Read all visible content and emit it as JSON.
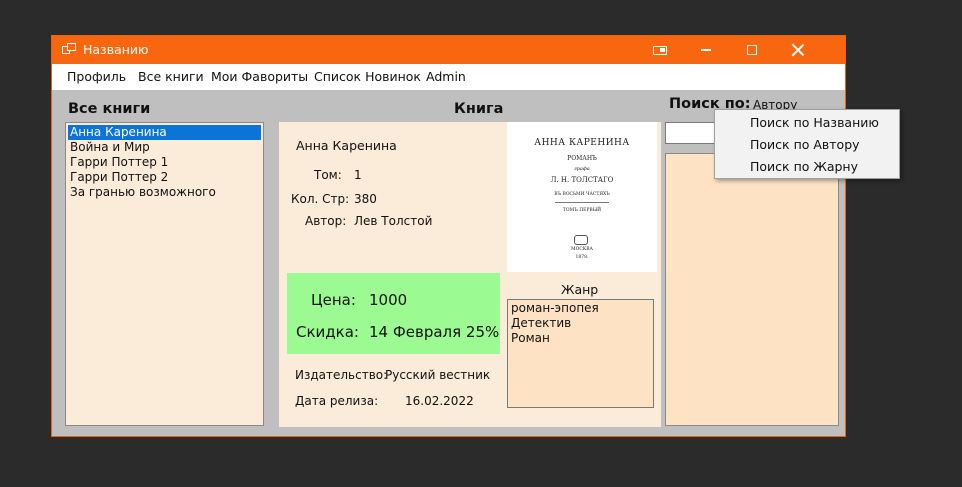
{
  "window": {
    "title": "Названию"
  },
  "menu": {
    "items": [
      "Профиль",
      "Все книги",
      "Мои Фавориты",
      "Список Новинок",
      "Admin"
    ]
  },
  "books": {
    "heading": "Все книги",
    "items": [
      "Анна Каренина",
      "Война и Мир",
      "Гарри Поттер 1",
      "Гарри Поттер 2",
      "За гранью возможного"
    ],
    "selected": "Анна Каренина"
  },
  "book": {
    "heading": "Книга",
    "title": "Анна Каренина",
    "volume_label": "Том:",
    "volume": "1",
    "pages_label": "Кол. Стр:",
    "pages": "380",
    "author_label": "Автор:",
    "author": "Лев Толстой",
    "price_label": "Цена:",
    "price": "1000",
    "discount_label": "Скидка:",
    "discount": "14 Февраля 25%",
    "publisher_label": "Издательство:",
    "publisher": "Русский вестник",
    "release_label": "Дата релиза:",
    "release": "16.02.2022",
    "genre_label": "Жанр",
    "genres": [
      "роман-эпопея",
      "Детектив",
      "Роман"
    ],
    "cover": {
      "line1": "АННА КАРЕНИНА",
      "line2": "РОМАНЪ",
      "line3": "графа",
      "line4": "Л. Н. ТОЛСТАГО",
      "line5": "ВЪ ВОСЬМИ ЧАСТЯХЪ",
      "line6": "ТОМЪ ПЕРВЫЙ",
      "line7": "МОСКВА",
      "line8": "1878."
    }
  },
  "search": {
    "label": "Поиск по:",
    "selected": "Автору",
    "options": [
      "Поиск по Названию",
      "Поиск по Автору",
      "Поиск по Жарну"
    ]
  },
  "colors": {
    "titlebar": "#f8670f",
    "panel": "#fbebd9",
    "price_box": "#9cfa92",
    "selection": "#0a74d8"
  }
}
